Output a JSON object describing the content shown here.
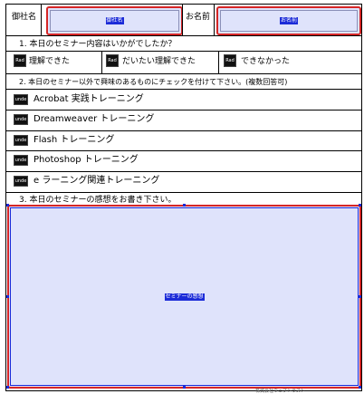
{
  "header": {
    "company_label": "御社名",
    "company_field": "御社名",
    "name_label": "お名前",
    "name_field": "お名前"
  },
  "q1": {
    "question": "1. 本日のセミナー内容はいかがでしたか？",
    "options": [
      {
        "icon": "Rad",
        "label": "理解できた"
      },
      {
        "icon": "Rad",
        "label": "だいたい理解できた"
      },
      {
        "icon": "Rad",
        "label": "できなかった"
      }
    ]
  },
  "q2": {
    "question": "2. 本日のセミナー以外で興味のあるものにチェックを付けて下さい。(複数回答可)",
    "options": [
      {
        "icon": "unde",
        "label": "Acrobat 実践トレーニング"
      },
      {
        "icon": "unde",
        "label": "Dreamweaver トレーニング"
      },
      {
        "icon": "unde",
        "label": "Flash トレーニング"
      },
      {
        "icon": "unde",
        "label": "Photoshop トレーニング"
      },
      {
        "icon": "unde",
        "label": "e ラーニング関連トレーニング"
      }
    ]
  },
  "q3": {
    "question": "3. 本日のセミナーの感想をお書き下さい。",
    "field": "セミナーの感想"
  },
  "footer": {
    "text": "株式会社ウェブトラスト"
  },
  "colors": {
    "field_fill": "#dfe3fb",
    "field_border": "#d62626",
    "selection": "#1b2bd8"
  }
}
